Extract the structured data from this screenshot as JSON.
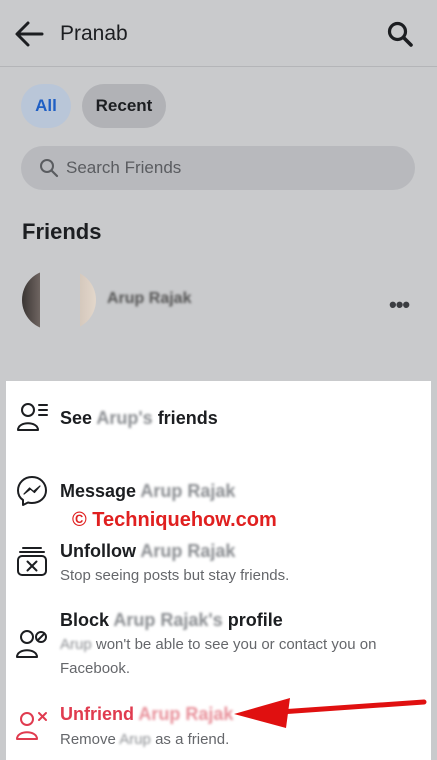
{
  "header": {
    "title": "Pranab"
  },
  "filters": {
    "all": "All",
    "recent": "Recent"
  },
  "search": {
    "placeholder": "Search Friends"
  },
  "section_title": "Friends",
  "friend": {
    "name": "Arup Rajak"
  },
  "sheet": {
    "see_friends": {
      "prefix": "See",
      "blurred": "Arup's",
      "suffix": "friends"
    },
    "message": {
      "label": "Message",
      "blurred": "Arup Rajak"
    },
    "unfollow": {
      "label": "Unfollow",
      "blurred": "Arup Rajak",
      "sub": "Stop seeing posts but stay friends."
    },
    "block": {
      "label": "Block",
      "blurred": "Arup Rajak's",
      "suffix": "profile",
      "sub_blurred": "Arup",
      "sub1": "won't be able to see you or contact you on",
      "sub2": "Facebook."
    },
    "unfriend": {
      "label": "Unfriend",
      "blurred": "Arup Rajak",
      "sub_prefix": "Remove",
      "sub_blurred": "Arup",
      "sub_suffix": "as a friend."
    }
  },
  "watermark": "© Techniquehow.com",
  "colors": {
    "accent_red": "#e03b4f",
    "watermark_red": "#e02020",
    "chip_blue": "#1f5fc4"
  }
}
